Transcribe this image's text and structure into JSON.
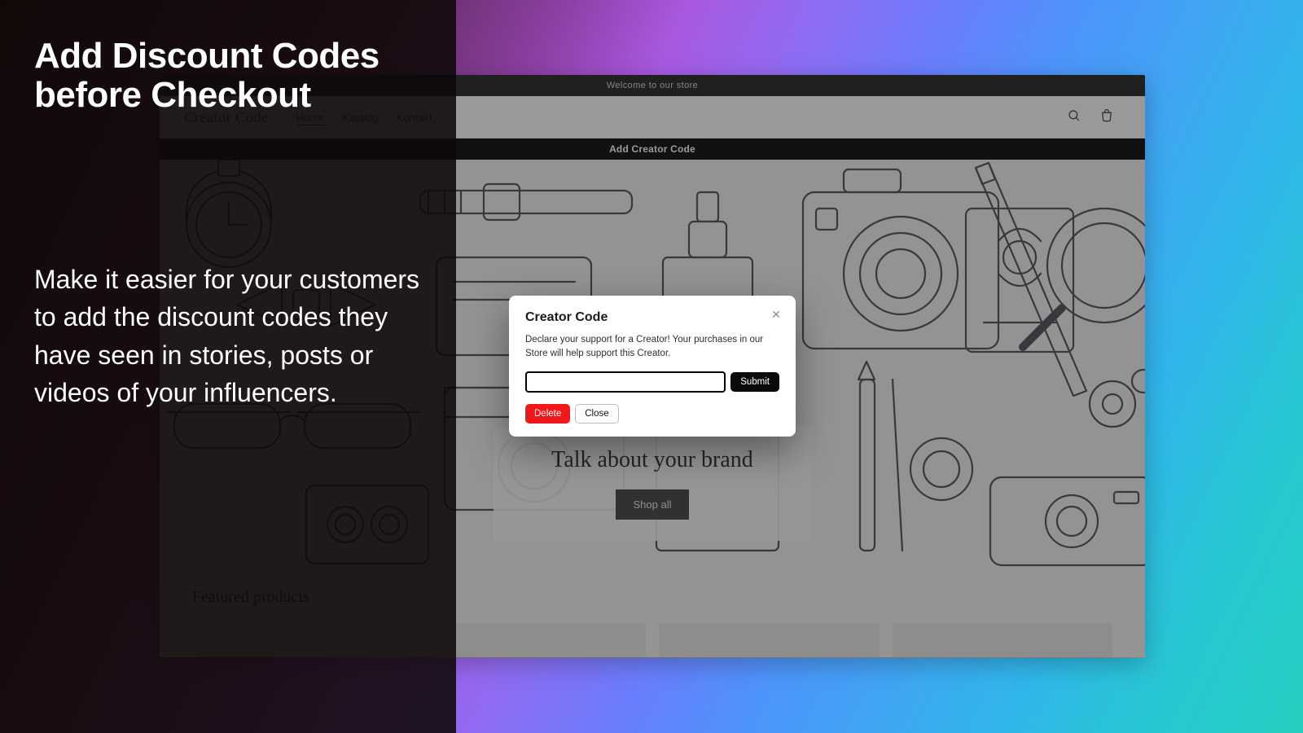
{
  "promo": {
    "heading": "Add Discount Codes before Checkout",
    "body": "Make it easier for your customers to add the discount codes they have seen in stories, posts or videos of your influencers."
  },
  "store": {
    "announcement": "Welcome to our store",
    "brand": "Creator Code",
    "nav": {
      "home": "Home",
      "katalog": "Katalog",
      "kontakt": "Kontakt"
    },
    "creator_bar": "Add Creator Code",
    "hero": {
      "headline": "Talk about your brand",
      "cta": "Shop all"
    },
    "featured_heading": "Featured products"
  },
  "modal": {
    "title": "Creator Code",
    "body": "Declare your support for a Creator! Your purchases in our Store will help support this Creator.",
    "submit": "Submit",
    "delete": "Delete",
    "close": "Close",
    "input_value": ""
  }
}
